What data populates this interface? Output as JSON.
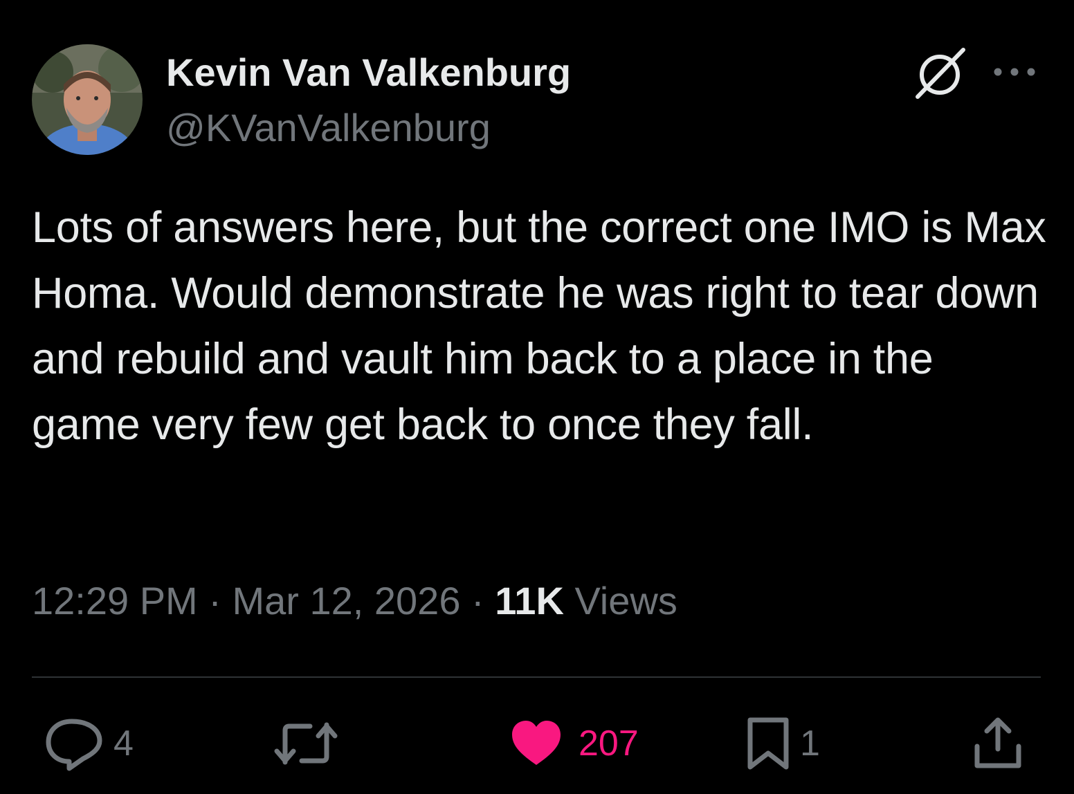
{
  "tweet": {
    "author": {
      "display_name": "Kevin Van Valkenburg",
      "handle": "@KVanValkenburg",
      "avatar_icon": "avatar-photo"
    },
    "text": "Lots of answers here, but the correct one IMO is Max Homa. Would demonstrate he was right to tear down and rebuild and vault him back to a place in the game very few get back to once they fall.",
    "time": "12:29 PM",
    "separator": "·",
    "date": "Mar 12, 2026",
    "views_count": "11K",
    "views_label": "Views"
  },
  "actions": {
    "replies": "4",
    "reposts": "",
    "likes": "207",
    "bookmarks": "1"
  },
  "icons": {
    "top_right": [
      "grok-icon",
      "more-icon"
    ],
    "actions": [
      "reply-icon",
      "repost-icon",
      "heart-icon",
      "bookmark-icon",
      "share-icon"
    ]
  },
  "colors": {
    "background": "#000000",
    "text_primary": "#e7e9ea",
    "text_secondary": "#71767b",
    "like_active": "#f91880",
    "divider": "#2f3336"
  }
}
